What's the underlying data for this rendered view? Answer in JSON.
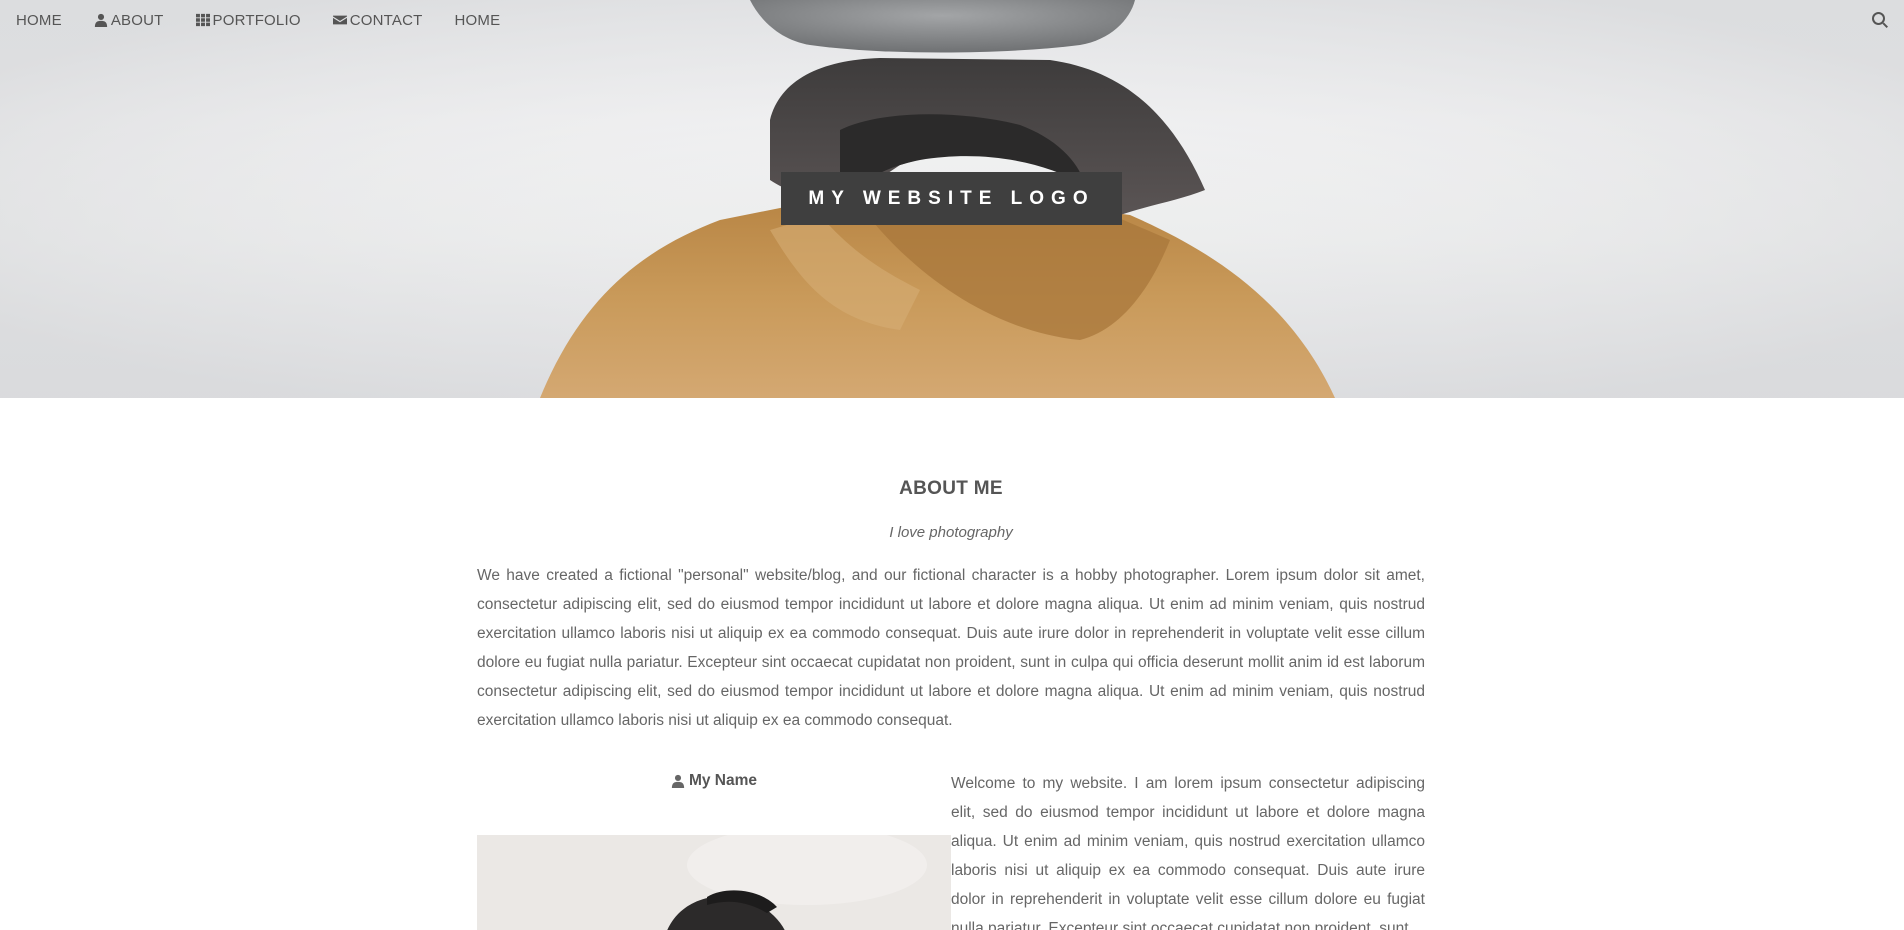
{
  "nav": {
    "items": [
      {
        "label": "HOME",
        "icon": ""
      },
      {
        "label": "ABOUT",
        "icon": "user-icon"
      },
      {
        "label": "PORTFOLIO",
        "icon": "th-grid-icon"
      },
      {
        "label": "CONTACT",
        "icon": "envelope-icon"
      },
      {
        "label": "HOME",
        "icon": ""
      }
    ],
    "search_icon": "search-icon"
  },
  "hero": {
    "logo_text": "MY WEBSITE LOGO"
  },
  "about": {
    "title": "ABOUT ME",
    "tagline": "I love photography",
    "intro": "We have created a fictional \"personal\" website/blog, and our fictional character is a hobby photographer. Lorem ipsum dolor sit amet, consectetur adipiscing elit, sed do eiusmod tempor incididunt ut labore et dolore magna aliqua. Ut enim ad minim veniam, quis nostrud exercitation ullamco laboris nisi ut aliquip ex ea commodo consequat. Duis aute irure dolor in reprehenderit in voluptate velit esse cillum dolore eu fugiat nulla pariatur. Excepteur sint occaecat cupidatat non proident, sunt in culpa qui officia deserunt mollit anim id est laborum consectetur adipiscing elit, sed do eiusmod tempor incididunt ut labore et dolore magna aliqua. Ut enim ad minim veniam, quis nostrud exercitation ullamco laboris nisi ut aliquip ex ea commodo consequat.",
    "name_label": "My Name",
    "welcome": "Welcome to my website. I am lorem ipsum consectetur adipiscing elit, sed do eiusmod tempor incididunt ut labore et dolore magna aliqua. Ut enim ad minim veniam, quis nostrud exercitation ullamco laboris nisi ut aliquip ex ea commodo consequat. Duis aute irure dolor in reprehenderit in voluptate velit esse cillum dolore eu fugiat nulla pariatur. Excepteur sint occaecat cupidatat non proident, sunt"
  },
  "colors": {
    "logo_bg": "#3f3f3f",
    "text": "#666666",
    "jacket": "#c0924f",
    "hat": "#8a8c8e"
  }
}
